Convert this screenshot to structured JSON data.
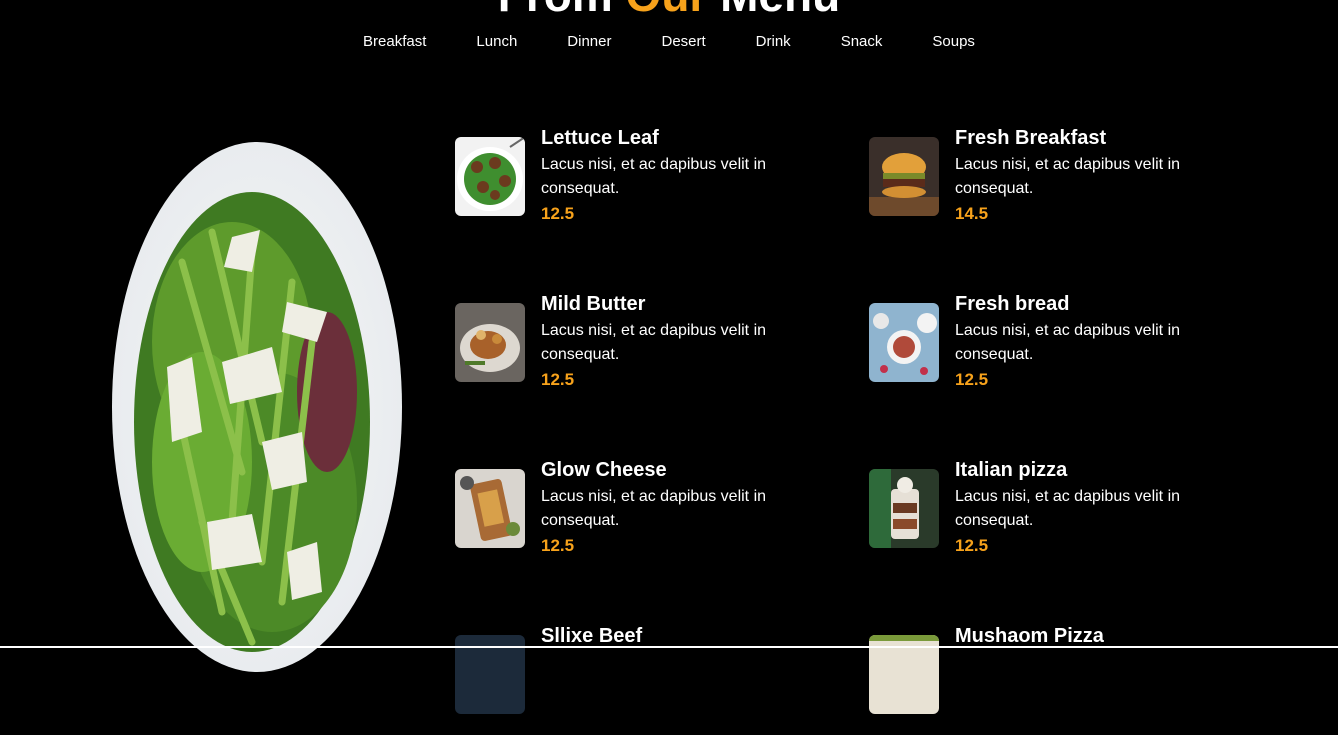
{
  "heading": {
    "prefix": "From ",
    "accent_word": "Our",
    "suffix": " Menu"
  },
  "tabs": [
    "Breakfast",
    "Lunch",
    "Dinner",
    "Desert",
    "Drink",
    "Snack",
    "Soups"
  ],
  "colors": {
    "accent": "#f7a21b",
    "background": "#000000",
    "text": "#ffffff"
  },
  "menu": {
    "items": [
      {
        "title": "Lettuce Leaf",
        "description": "Lacus nisi, et ac dapibus velit in consequat.",
        "price": "12.5",
        "image": "meatballs-salad-image"
      },
      {
        "title": "Fresh Breakfast",
        "description": "Lacus nisi, et ac dapibus velit in consequat.",
        "price": "14.5",
        "image": "burger-image"
      },
      {
        "title": "Mild Butter",
        "description": "Lacus nisi, et ac dapibus velit in consequat.",
        "price": "12.5",
        "image": "roast-plate-image"
      },
      {
        "title": "Fresh bread",
        "description": "Lacus nisi, et ac dapibus velit in consequat.",
        "price": "12.5",
        "image": "breakfast-bowls-image"
      },
      {
        "title": "Glow Cheese",
        "description": "Lacus nisi, et ac dapibus velit in consequat.",
        "price": "12.5",
        "image": "board-snacks-image"
      },
      {
        "title": "Italian pizza",
        "description": "Lacus nisi, et ac dapibus velit in consequat.",
        "price": "12.5",
        "image": "parfait-glass-image"
      },
      {
        "title": "Sllixe Beef",
        "description": "",
        "price": "",
        "image": "beef-image"
      },
      {
        "title": "Mushaom Pizza",
        "description": "",
        "price": "",
        "image": "pizza-image"
      }
    ]
  }
}
